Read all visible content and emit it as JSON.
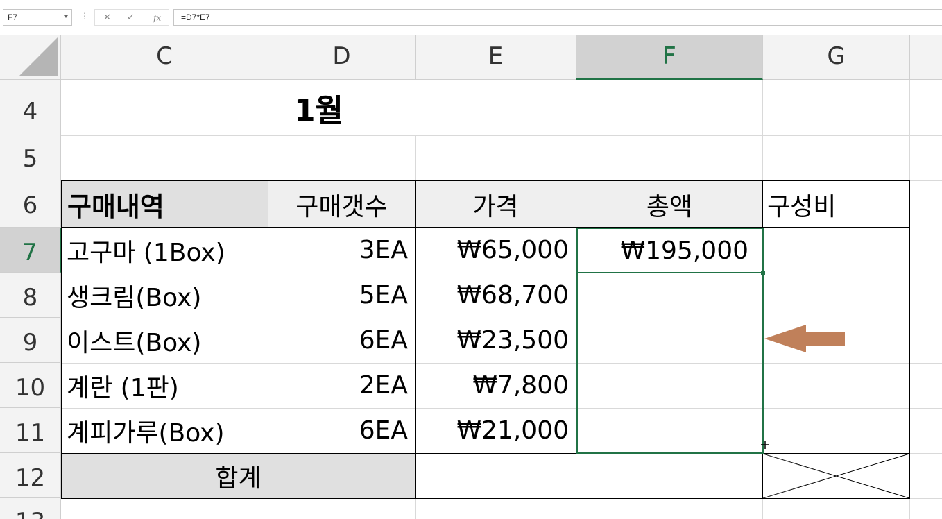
{
  "formula_bar": {
    "name_box": "F7",
    "formula": "=D7*E7",
    "cancel_glyph": "✕",
    "enter_glyph": "✓",
    "fx_glyph": "fx"
  },
  "columns": [
    "C",
    "D",
    "E",
    "F",
    "G"
  ],
  "rows": [
    "4",
    "5",
    "6",
    "7",
    "8",
    "9",
    "10",
    "11",
    "12",
    "13"
  ],
  "sheet": {
    "title": "1월",
    "headers": {
      "item": "구매내역",
      "qty": "구매갯수",
      "price": "가격",
      "total": "총액",
      "ratio": "구성비"
    },
    "items": [
      {
        "name": "고구마 (1Box)",
        "qty": "3EA",
        "price": "₩65,000",
        "total": "₩195,000"
      },
      {
        "name": "생크림(Box)",
        "qty": "5EA",
        "price": "₩68,700",
        "total": ""
      },
      {
        "name": "이스트(Box)",
        "qty": "6EA",
        "price": "₩23,500",
        "total": ""
      },
      {
        "name": "계란 (1판)",
        "qty": "2EA",
        "price": "₩7,800",
        "total": ""
      },
      {
        "name": "계피가루(Box)",
        "qty": "6EA",
        "price": "₩21,000",
        "total": ""
      }
    ],
    "sum_label": "합계"
  },
  "colors": {
    "selection": "#217346",
    "arrow": "#c0805a",
    "header_bg": "#f3f3f3"
  },
  "icons": [
    "dropdown-arrow-icon",
    "cancel-icon",
    "enter-icon",
    "fx-icon",
    "left-arrow-shape",
    "fill-cursor-icon"
  ]
}
